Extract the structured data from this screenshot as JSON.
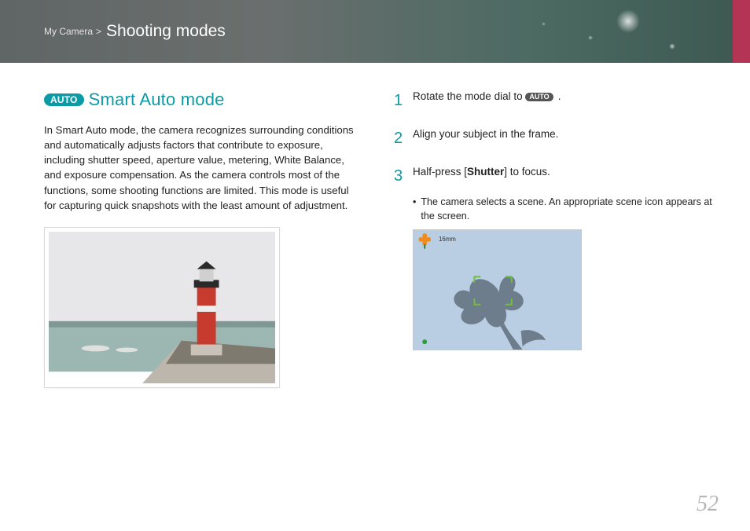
{
  "header": {
    "breadcrumb": "My Camera",
    "separator": ">",
    "title": "Shooting modes"
  },
  "section": {
    "badge": "AUTO",
    "title": "Smart Auto mode",
    "body": "In Smart Auto mode, the camera recognizes surrounding conditions and automatically adjusts factors that contribute to exposure, including shutter speed, aperture value, metering, White Balance, and exposure compensation. As the camera controls most of the functions, some shooting functions are limited. This mode is useful for capturing quick snapshots with the least amount of adjustment."
  },
  "steps": {
    "s1_pre": "Rotate the mode dial to ",
    "s1_badge": "AUTO",
    "s1_post": ".",
    "s2": "Align your subject in the frame.",
    "s3_pre": "Half-press [",
    "s3_bold": "Shutter",
    "s3_post": "] to focus.",
    "s3_sub": "The camera selects a scene. An appropriate scene icon appears at the screen."
  },
  "scene": {
    "focal": "16mm"
  },
  "page_number": "52",
  "colors": {
    "accent": "#0b9ba6",
    "brand_stripe": "#b43456"
  }
}
